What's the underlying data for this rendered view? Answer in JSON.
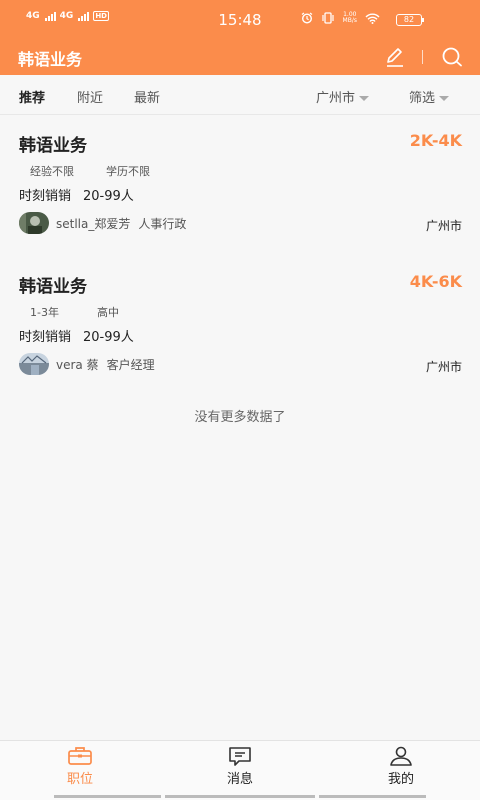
{
  "status_bar": {
    "sim1": "4G",
    "sim2": "4G",
    "hd": "HD",
    "time": "15:48",
    "speed_value": "1.00",
    "speed_unit": "MB/s",
    "battery": "82"
  },
  "header": {
    "title": "韩语业务",
    "edit_icon": "edit-icon",
    "search_icon": "search-icon"
  },
  "tabs": [
    {
      "label": "推荐",
      "active": true
    },
    {
      "label": "附近",
      "active": false
    },
    {
      "label": "最新",
      "active": false
    }
  ],
  "filters": {
    "city": "广州市",
    "filter": "筛选"
  },
  "jobs": [
    {
      "title": "韩语业务",
      "salary": "2K-4K",
      "tags": [
        "经验不限",
        "学历不限"
      ],
      "company": "时刻销销",
      "size": "20-99人",
      "recruiter_name": "setlla_郑爱芳",
      "recruiter_role": "人事行政",
      "city": "广州市"
    },
    {
      "title": "韩语业务",
      "salary": "4K-6K",
      "tags": [
        "1-3年",
        "高中"
      ],
      "company": "时刻销销",
      "size": "20-99人",
      "recruiter_name": "vera 蔡",
      "recruiter_role": "客户经理",
      "city": "广州市"
    }
  ],
  "no_more_text": "没有更多数据了",
  "bottom_nav": [
    {
      "label": "职位",
      "icon": "briefcase-icon",
      "active": true
    },
    {
      "label": "消息",
      "icon": "message-icon",
      "active": false
    },
    {
      "label": "我的",
      "icon": "profile-icon",
      "active": false
    }
  ],
  "colors": {
    "accent": "#fb8c4b",
    "background": "#f7f7f7"
  }
}
